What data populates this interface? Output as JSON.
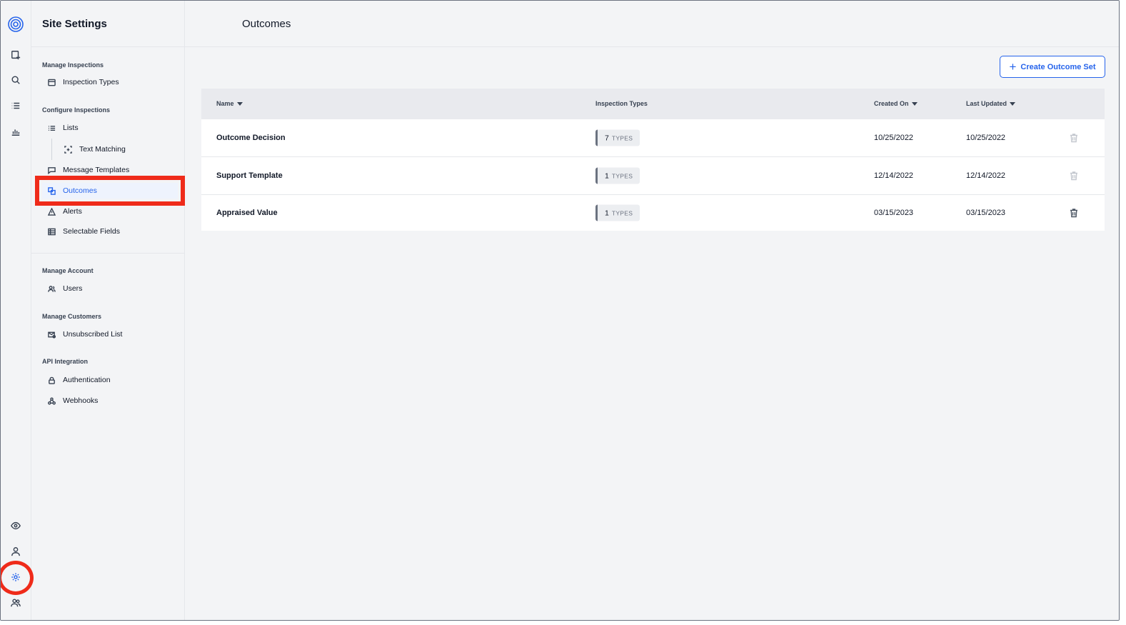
{
  "sidebar": {
    "title": "Site Settings",
    "sections": [
      {
        "label": "Manage Inspections"
      },
      {
        "label": "Configure Inspections"
      },
      {
        "label": "Manage Account"
      },
      {
        "label": "Manage Customers"
      },
      {
        "label": "API Integration"
      }
    ],
    "items": {
      "inspection_types": "Inspection Types",
      "lists": "Lists",
      "text_matching": "Text Matching",
      "message_templates": "Message Templates",
      "outcomes": "Outcomes",
      "alerts": "Alerts",
      "selectable_fields": "Selectable Fields",
      "users": "Users",
      "unsubscribed_list": "Unsubscribed List",
      "authentication": "Authentication",
      "webhooks": "Webhooks"
    },
    "active_item": "Outcomes"
  },
  "main": {
    "title": "Outcomes",
    "create_button": "Create Outcome Set",
    "table": {
      "columns": {
        "name": "Name",
        "inspection_types": "Inspection Types",
        "created_on": "Created On",
        "last_updated": "Last Updated"
      },
      "types_label": "TYPES",
      "rows": [
        {
          "name": "Outcome Decision",
          "types": "7",
          "created_on": "10/25/2022",
          "last_updated": "10/25/2022"
        },
        {
          "name": "Support Template",
          "types": "1",
          "created_on": "12/14/2022",
          "last_updated": "12/14/2022"
        },
        {
          "name": "Appraised Value",
          "types": "1",
          "created_on": "03/15/2023",
          "last_updated": "03/15/2023"
        }
      ]
    }
  },
  "colors": {
    "accent": "#2563eb",
    "highlight": "#ef2b1a",
    "background": "#f3f4f6"
  }
}
